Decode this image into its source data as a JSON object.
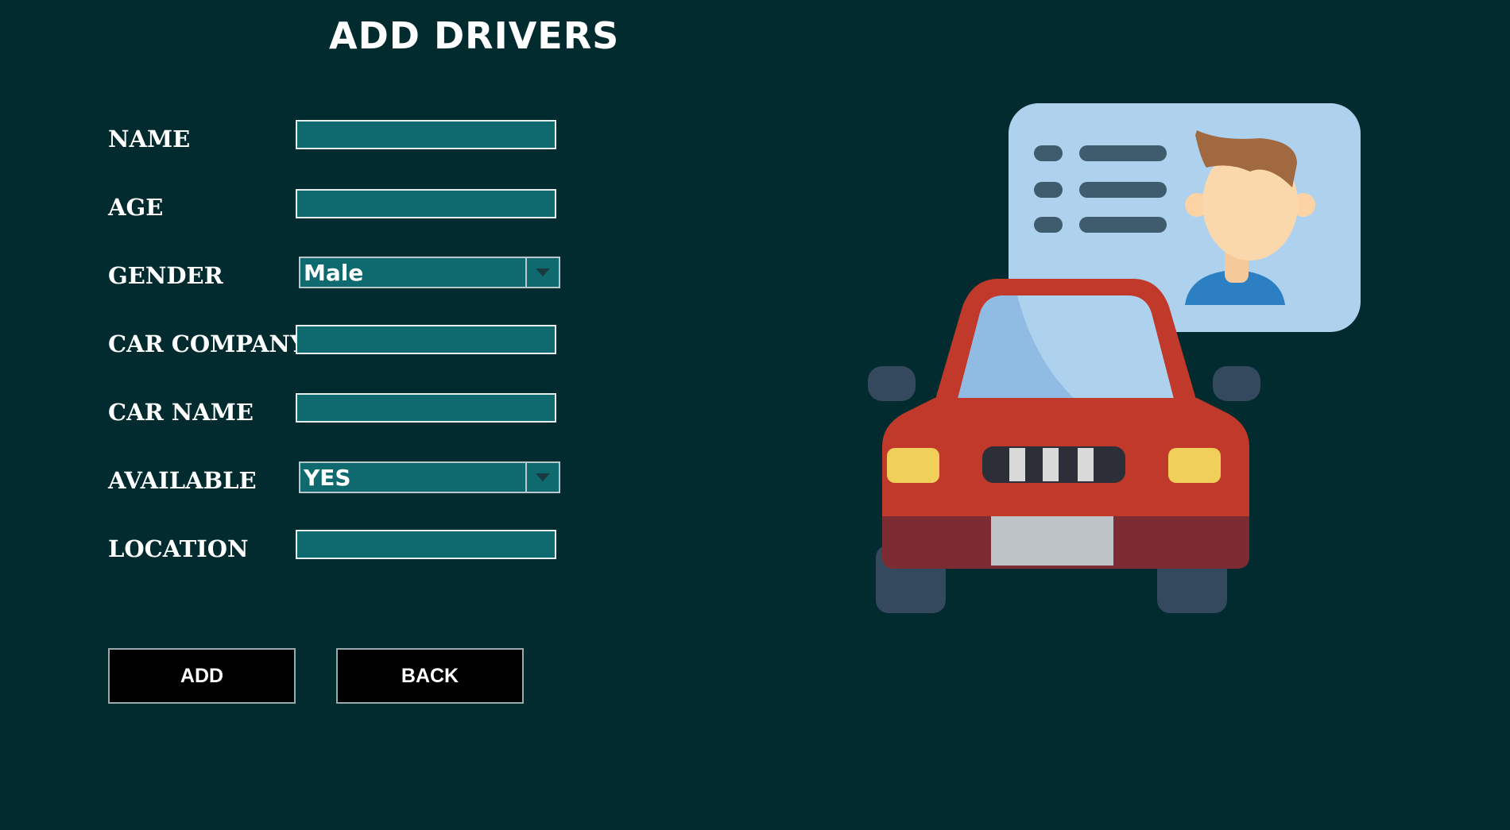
{
  "title": "ADD DRIVERS",
  "form": {
    "name": {
      "label": "NAME",
      "value": ""
    },
    "age": {
      "label": "AGE",
      "value": ""
    },
    "gender": {
      "label": "GENDER",
      "selected": "Male"
    },
    "car_company": {
      "label": "CAR COMPANY",
      "value": ""
    },
    "car_name": {
      "label": "CAR NAME",
      "value": ""
    },
    "available": {
      "label": "AVAILABLE",
      "selected": "YES"
    },
    "location": {
      "label": "LOCATION",
      "value": ""
    }
  },
  "buttons": {
    "add": "ADD",
    "back": "BACK"
  },
  "illustration": {
    "icon": "driver-license-car-illustration",
    "colors": {
      "background": "#022b2f",
      "field": "#0e6a6f",
      "card": "#aed2ee",
      "car_body": "#c0392b",
      "windshield": "#90bbe3",
      "headlight": "#f0d05a"
    }
  }
}
